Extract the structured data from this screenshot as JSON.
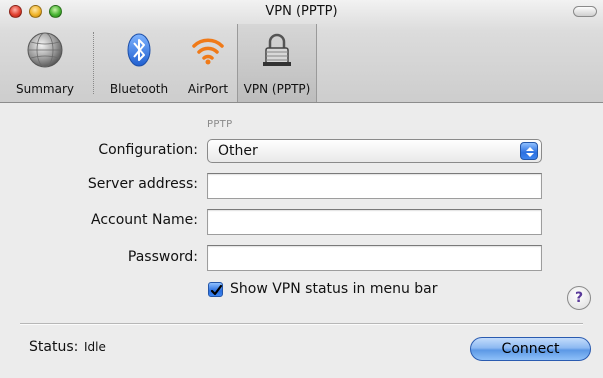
{
  "window": {
    "title": "VPN (PPTP)"
  },
  "toolbar": {
    "items": [
      {
        "label": "Summary",
        "icon": "globe-icon",
        "selected": false
      },
      {
        "label": "Bluetooth",
        "icon": "bluetooth-icon",
        "selected": false
      },
      {
        "label": "AirPort",
        "icon": "airport-wifi-icon",
        "selected": false
      },
      {
        "label": "VPN (PPTP)",
        "icon": "lock-icon",
        "selected": true
      }
    ]
  },
  "form": {
    "section_label": "PPTP",
    "configuration": {
      "label": "Configuration:",
      "value": "Other"
    },
    "server_address": {
      "label": "Server address:",
      "value": ""
    },
    "account_name": {
      "label": "Account Name:",
      "value": ""
    },
    "password": {
      "label": "Password:",
      "value": ""
    },
    "show_status": {
      "label": "Show VPN status in menu bar",
      "checked": true
    }
  },
  "help": {
    "symbol": "?"
  },
  "status": {
    "label": "Status:",
    "value": "Idle"
  },
  "connect_button": {
    "label": "Connect"
  },
  "colors": {
    "accent_blue": "#2a6fe0",
    "window_bg": "#ececec"
  }
}
